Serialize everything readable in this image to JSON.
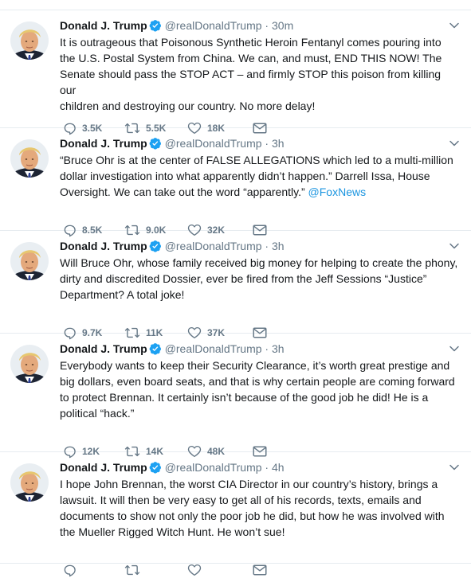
{
  "tweets": [
    {
      "name": "Donald J. Trump",
      "handle": "@realDonaldTrump",
      "time": "30m",
      "lines": [
        "It is outrageous that Poisonous Synthetic Heroin Fentanyl comes pouring into",
        "the U.S. Postal System from China. We can, and must, END THIS NOW! The",
        "Senate should pass the STOP ACT – and firmly STOP this poison from killing our",
        "children and destroying our country. No more delay!"
      ],
      "link": "",
      "replies": "3.5K",
      "retweets": "5.5K",
      "likes": "18K"
    },
    {
      "name": "Donald J. Trump",
      "handle": "@realDonaldTrump",
      "time": "3h",
      "lines": [
        "“Bruce Ohr is at the center of FALSE ALLEGATIONS which led to a multi-million",
        "dollar investigation into what apparently didn’t happen.” Darrell Issa, House",
        "Oversight. We can take out the word “apparently.”"
      ],
      "link": "@FoxNews",
      "replies": "8.5K",
      "retweets": "9.0K",
      "likes": "32K"
    },
    {
      "name": "Donald J. Trump",
      "handle": "@realDonaldTrump",
      "time": "3h",
      "lines": [
        "Will Bruce Ohr, whose family received big money for helping to create the phony,",
        "dirty and discredited Dossier, ever be fired from the Jeff Sessions  “Justice”",
        "Department? A total joke!"
      ],
      "link": "",
      "replies": "9.7K",
      "retweets": "11K",
      "likes": "37K"
    },
    {
      "name": "Donald J. Trump",
      "handle": "@realDonaldTrump",
      "time": "3h",
      "lines": [
        "Everybody wants to keep their Security Clearance, it’s worth great prestige and",
        "big dollars, even board seats, and that is why certain people are coming forward",
        "to protect Brennan. It certainly isn’t because of the good job he did! He is a",
        "political “hack.”"
      ],
      "link": "",
      "replies": "12K",
      "retweets": "14K",
      "likes": "48K"
    },
    {
      "name": "Donald J. Trump",
      "handle": "@realDonaldTrump",
      "time": "4h",
      "lines": [
        "I hope John Brennan, the worst CIA Director in our country’s history, brings a",
        "lawsuit. It will then be very easy to get all of his records, texts, emails and",
        "documents to show not only the poor job he did, but how he was involved with",
        "the Mueller Rigged Witch Hunt. He won’t sue!"
      ],
      "link": "",
      "replies": "",
      "retweets": "",
      "likes": ""
    }
  ],
  "icons": {
    "verified": "verified-badge-icon",
    "caret": "chevron-down-icon",
    "reply": "reply-icon",
    "retweet": "retweet-icon",
    "like": "heart-icon",
    "dm": "envelope-icon"
  },
  "colors": {
    "link": "#1b95e0",
    "verified": "#1da1f2",
    "muted": "#657786",
    "divider": "#e6ecf0"
  }
}
